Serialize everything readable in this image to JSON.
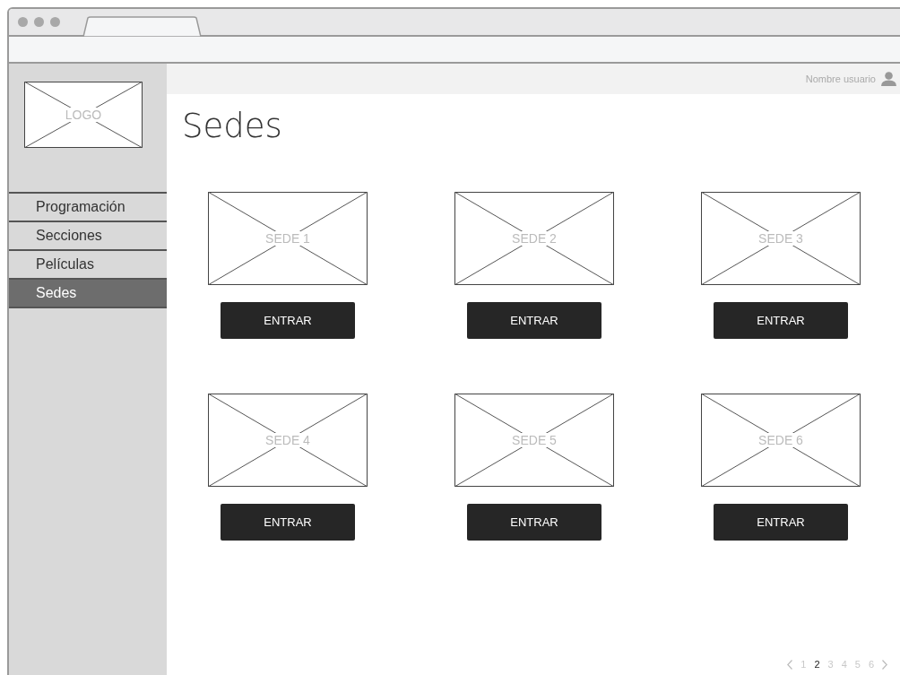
{
  "logo": {
    "label": "LOGO"
  },
  "user": {
    "name": "Nombre usuario"
  },
  "sidebar": {
    "items": [
      {
        "label": "Programación",
        "selected": false
      },
      {
        "label": "Secciones",
        "selected": false
      },
      {
        "label": "Películas",
        "selected": false
      },
      {
        "label": "Sedes",
        "selected": true
      }
    ]
  },
  "page_title": "Sedes",
  "sedes": [
    {
      "label": "SEDE 1",
      "button": "ENTRAR"
    },
    {
      "label": "SEDE 2",
      "button": "ENTRAR"
    },
    {
      "label": "SEDE 3",
      "button": "ENTRAR"
    },
    {
      "label": "SEDE 4",
      "button": "ENTRAR"
    },
    {
      "label": "SEDE 5",
      "button": "ENTRAR"
    },
    {
      "label": "SEDE 6",
      "button": "ENTRAR"
    }
  ],
  "pagination": {
    "pages": [
      {
        "label": "1",
        "selected": false
      },
      {
        "label": "2",
        "selected": true
      },
      {
        "label": "3",
        "selected": false
      },
      {
        "label": "4",
        "selected": false
      },
      {
        "label": "5",
        "selected": false
      },
      {
        "label": "6",
        "selected": false
      }
    ]
  }
}
